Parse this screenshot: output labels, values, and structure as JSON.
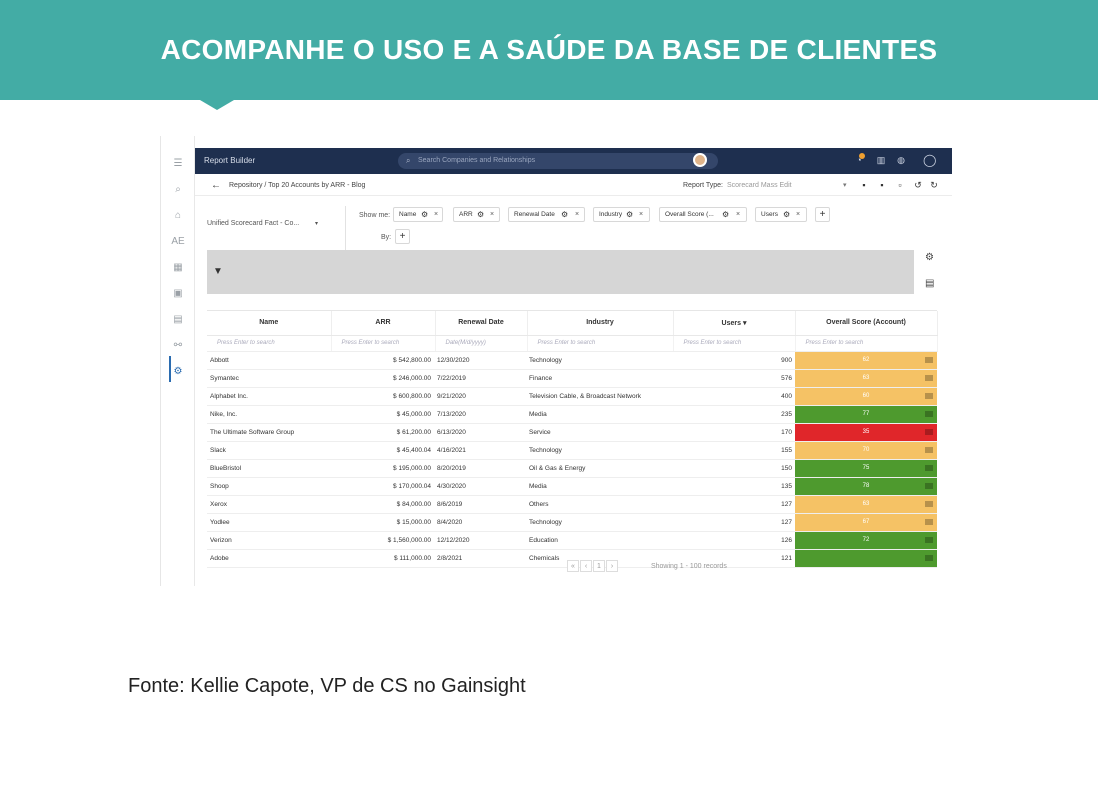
{
  "banner": {
    "title": "ACOMPANHE O USO E A SAÚDE DA BASE DE CLIENTES",
    "color": "#43aca5"
  },
  "app": {
    "title": "Report Builder",
    "search_placeholder": "Search Companies and Relationships",
    "breadcrumb": "Repository / Top 20 Accounts by ARR - Blog",
    "report_type_label": "Report Type:",
    "report_type_value": "Scorecard Mass Edit",
    "view_select": "Unified Scorecard Fact - Co...",
    "show_me_label": "Show me:",
    "by_label": "By:",
    "chips": [
      "Name",
      "ARR",
      "Renewal Date",
      "Industry",
      "Overall Score (...",
      "Users"
    ],
    "columns": [
      "Name",
      "ARR",
      "Renewal Date",
      "Industry",
      "Users",
      "Overall Score (Account)"
    ],
    "search_placeholders": [
      "Press Enter to search",
      "Press Enter to search",
      "Date(M/d/yyyy)",
      "Press Enter to search",
      "Press Enter to search",
      "Press Enter to search"
    ],
    "rows": [
      {
        "name": "Abbott",
        "arr": "$ 542,800.00",
        "date": "12/30/2020",
        "industry": "Technology",
        "users": "900",
        "score": "62",
        "color": "#f5c265"
      },
      {
        "name": "Symantec",
        "arr": "$ 246,000.00",
        "date": "7/22/2019",
        "industry": "Finance",
        "users": "576",
        "score": "63",
        "color": "#f5c265"
      },
      {
        "name": "Alphabet Inc.",
        "arr": "$ 600,800.00",
        "date": "9/21/2020",
        "industry": "Television Cable, & Broadcast Network",
        "users": "400",
        "score": "60",
        "color": "#f5c265"
      },
      {
        "name": "Nike, Inc.",
        "arr": "$ 45,000.00",
        "date": "7/13/2020",
        "industry": "Media",
        "users": "235",
        "score": "77",
        "color": "#4e9a2e"
      },
      {
        "name": "The Ultimate Software Group",
        "arr": "$ 61,200.00",
        "date": "6/13/2020",
        "industry": "Service",
        "users": "170",
        "score": "35",
        "color": "#e0262a"
      },
      {
        "name": "Slack",
        "arr": "$ 45,400.04",
        "date": "4/16/2021",
        "industry": "Technology",
        "users": "155",
        "score": "70",
        "color": "#f5c265"
      },
      {
        "name": "BlueBristol",
        "arr": "$ 195,000.00",
        "date": "8/20/2019",
        "industry": "Oil & Gas & Energy",
        "users": "150",
        "score": "75",
        "color": "#4e9a2e"
      },
      {
        "name": "Shoop",
        "arr": "$ 170,000.04",
        "date": "4/30/2020",
        "industry": "Media",
        "users": "135",
        "score": "78",
        "color": "#4e9a2e"
      },
      {
        "name": "Xerox",
        "arr": "$ 84,000.00",
        "date": "8/6/2019",
        "industry": "Others",
        "users": "127",
        "score": "63",
        "color": "#f5c265"
      },
      {
        "name": "Yodlee",
        "arr": "$ 15,000.00",
        "date": "8/4/2020",
        "industry": "Technology",
        "users": "127",
        "score": "67",
        "color": "#f5c265"
      },
      {
        "name": "Verizon",
        "arr": "$ 1,560,000.00",
        "date": "12/12/2020",
        "industry": "Education",
        "users": "126",
        "score": "72",
        "color": "#4e9a2e"
      },
      {
        "name": "Adobe",
        "arr": "$ 111,000.00",
        "date": "2/8/2021",
        "industry": "Chemicals",
        "users": "121",
        "score": "",
        "color": "#4e9a2e"
      }
    ],
    "pager": {
      "page": "1",
      "showing": "Showing 1 - 100 records"
    }
  },
  "source": "Fonte: Kellie Capote, VP de CS no Gainsight"
}
